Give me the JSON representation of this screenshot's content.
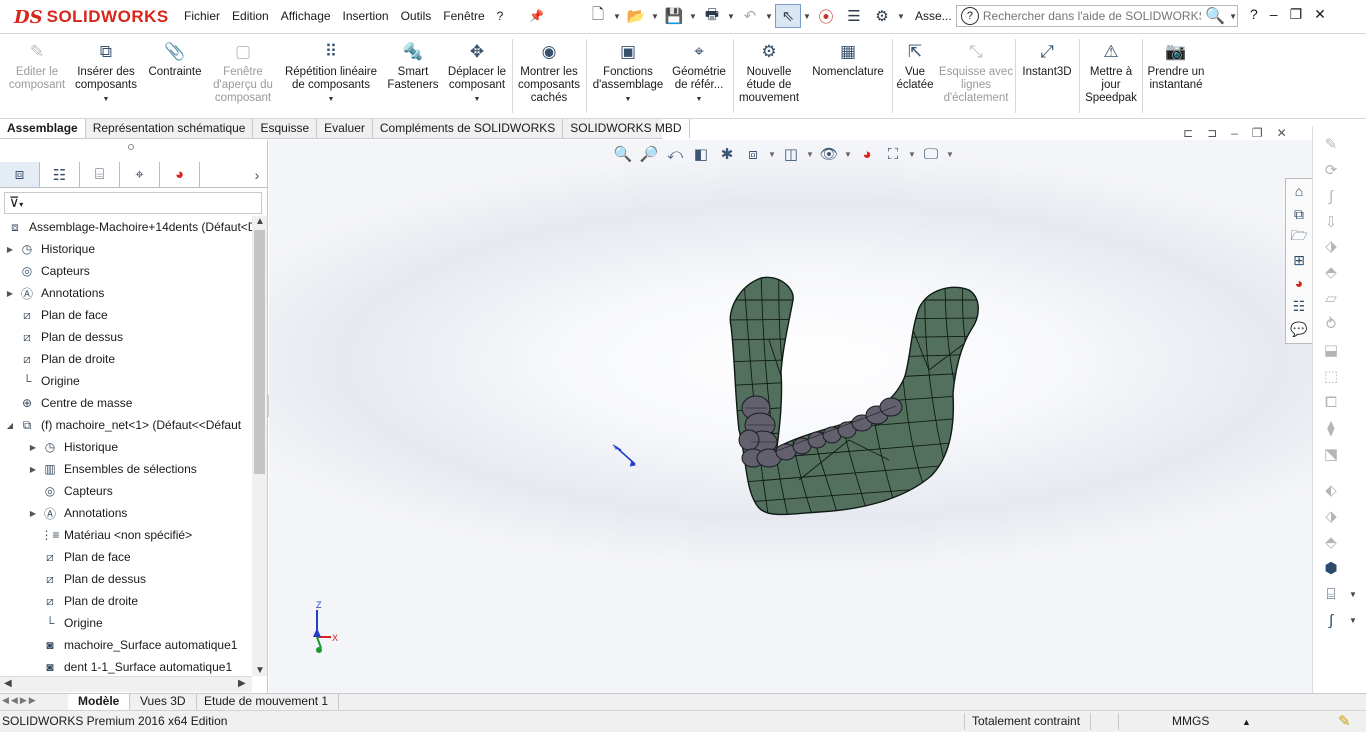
{
  "app": {
    "logo_prefix": "DS",
    "logo_text": "SOLIDWORKS"
  },
  "menu": [
    "Fichier",
    "Edition",
    "Affichage",
    "Insertion",
    "Outils",
    "Fenêtre",
    "?"
  ],
  "quick_access": {
    "truncated_label": "Asse...",
    "search_placeholder": "Rechercher dans l'aide de SOLIDWORKS",
    "help_label": "?"
  },
  "command_manager": [
    {
      "label": "Editer le composant",
      "icon": "edit-component-icon",
      "enabled": false
    },
    {
      "label": "Insérer des composants",
      "icon": "insert-components-icon",
      "enabled": true,
      "dropdown": true
    },
    {
      "label": "Contrainte",
      "icon": "mate-paperclip-icon",
      "enabled": true
    },
    {
      "label": "Fenêtre d'aperçu du composant",
      "icon": "component-preview-icon",
      "enabled": false
    },
    {
      "label": "Répétition linéaire de composants",
      "icon": "linear-pattern-icon",
      "enabled": true,
      "dropdown": true
    },
    {
      "label": "Smart Fasteners",
      "icon": "smart-fasteners-icon",
      "enabled": true
    },
    {
      "label": "Déplacer le composant",
      "icon": "move-component-icon",
      "enabled": true,
      "dropdown": true
    },
    {
      "label": "Montrer les composants cachés",
      "icon": "show-hidden-icon",
      "enabled": true
    },
    {
      "label": "Fonctions d'assemblage",
      "icon": "assembly-features-icon",
      "enabled": true,
      "dropdown": true
    },
    {
      "label": "Géométrie de référ...",
      "icon": "reference-geometry-icon",
      "enabled": true,
      "dropdown": true
    },
    {
      "label": "Nouvelle étude de mouvement",
      "icon": "motion-study-icon",
      "enabled": true
    },
    {
      "label": "Nomenclature",
      "icon": "bom-icon",
      "enabled": true
    },
    {
      "label": "Vue éclatée",
      "icon": "exploded-view-icon",
      "enabled": true
    },
    {
      "label": "Esquisse avec lignes d'éclatement",
      "icon": "explode-line-sketch-icon",
      "enabled": false
    },
    {
      "label": "Instant3D",
      "icon": "instant3d-icon",
      "enabled": true
    },
    {
      "label": "Mettre à jour Speedpak",
      "icon": "speedpak-icon",
      "enabled": true
    },
    {
      "label": "Prendre un instantané",
      "icon": "snapshot-camera-icon",
      "enabled": true
    }
  ],
  "tabs": [
    "Assemblage",
    "Représentation schématique",
    "Esquisse",
    "Evaluer",
    "Compléments de SOLIDWORKS",
    "SOLIDWORKS MBD"
  ],
  "active_tab": "Assemblage",
  "feature_tree": {
    "root": "Assemblage-Machoire+14dents  (Défaut<D",
    "items": [
      {
        "label": "Historique",
        "level": 1,
        "expand": true
      },
      {
        "label": "Capteurs",
        "level": 1
      },
      {
        "label": "Annotations",
        "level": 1,
        "expand": true
      },
      {
        "label": "Plan de face",
        "level": 1
      },
      {
        "label": "Plan de dessus",
        "level": 1
      },
      {
        "label": "Plan de droite",
        "level": 1
      },
      {
        "label": "Origine",
        "level": 1
      },
      {
        "label": "Centre de masse",
        "level": 1
      },
      {
        "label": "(f) machoire_net<1> (Défaut<<Défaut",
        "level": 1,
        "expanded": true
      },
      {
        "label": "Historique",
        "level": 2,
        "expand": true
      },
      {
        "label": "Ensembles de sélections",
        "level": 2,
        "expand": true
      },
      {
        "label": "Capteurs",
        "level": 2
      },
      {
        "label": "Annotations",
        "level": 2,
        "expand": true
      },
      {
        "label": "Matériau <non spécifié>",
        "level": 2
      },
      {
        "label": "Plan de face",
        "level": 2
      },
      {
        "label": "Plan de dessus",
        "level": 2
      },
      {
        "label": "Plan de droite",
        "level": 2
      },
      {
        "label": "Origine",
        "level": 2
      },
      {
        "label": "machoire_Surface automatique1",
        "level": 2
      },
      {
        "label": "dent 1-1_Surface automatique1",
        "level": 2
      }
    ]
  },
  "bottom_tabs": [
    "Modèle",
    "Vues 3D",
    "Etude de mouvement 1"
  ],
  "active_bottom_tab": "Modèle",
  "status": {
    "edition": "SOLIDWORKS Premium 2016 x64 Edition",
    "constraint": "Totalement contraint",
    "units": "MMGS"
  },
  "triad": {
    "z": "Z",
    "x": "X"
  },
  "colors": {
    "logo_red": "#d9261c",
    "jaw_fill": "#53705e",
    "teeth_fill": "#62606c",
    "mesh_lines": "#0e1a14"
  }
}
